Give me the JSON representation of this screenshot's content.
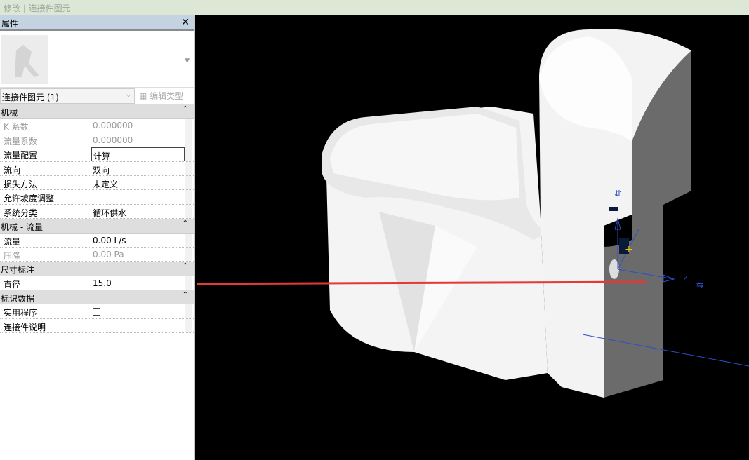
{
  "title": "修改 | 连接件图元",
  "panel": {
    "title": "属性",
    "close": "✕",
    "selector": "连接件图元 (1)",
    "edit_type": "编辑类型",
    "groups": [
      {
        "label": "机械",
        "rows": [
          {
            "k": "K 系数",
            "v": "0.000000",
            "dim": true
          },
          {
            "k": "流量系数",
            "v": "0.000000",
            "dim": true
          },
          {
            "k": "流量配置",
            "v": "计算",
            "boxed": true
          },
          {
            "k": "流向",
            "v": "双向"
          },
          {
            "k": "损失方法",
            "v": "未定义"
          },
          {
            "k": "允许坡度调整",
            "cb": true
          },
          {
            "k": "系统分类",
            "v": "循环供水"
          }
        ]
      },
      {
        "label": "机械 - 流量",
        "rows": [
          {
            "k": "流量",
            "v": "0.00 L/s"
          },
          {
            "k": "压降",
            "v": "0.00 Pa",
            "dim": true
          }
        ]
      },
      {
        "label": "尺寸标注",
        "rows": [
          {
            "k": "直径",
            "v": "15.0"
          }
        ]
      },
      {
        "label": "标识数据",
        "rows": [
          {
            "k": "实用程序",
            "cb": true
          },
          {
            "k": "连接件说明",
            "v": ""
          }
        ]
      }
    ]
  },
  "viewport": {
    "axis_label": "Z"
  },
  "colors": {
    "arrow": "#e53935",
    "axis": "#2a4fc9"
  }
}
